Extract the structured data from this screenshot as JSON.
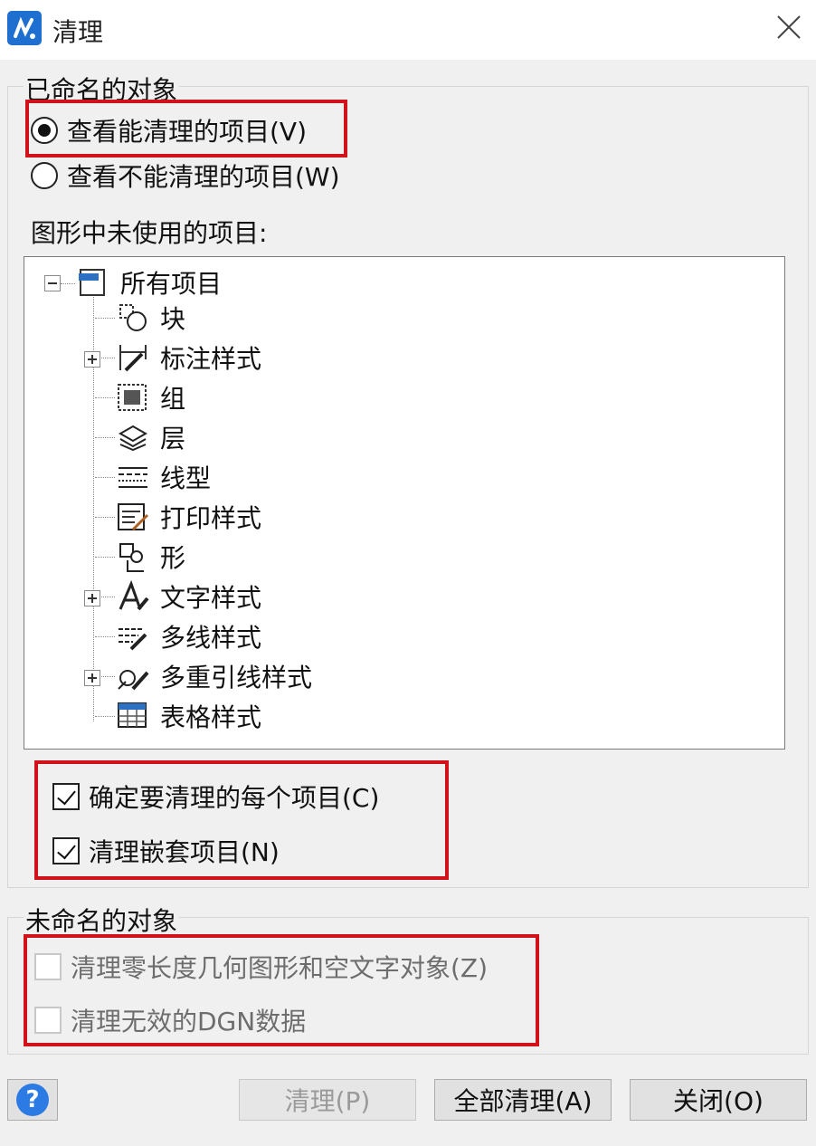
{
  "window": {
    "title": "清理"
  },
  "named_group": {
    "title": "已命名的对象",
    "radio_can_purge": "查看能清理的项目(V)",
    "radio_cannot_purge": "查看不能清理的项目(W)",
    "unused_label": "图形中未使用的项目:",
    "tree": {
      "root": "所有项目",
      "items": [
        "块",
        "标注样式",
        "组",
        "层",
        "线型",
        "打印样式",
        "形",
        "文字样式",
        "多线样式",
        "多重引线样式",
        "表格样式"
      ]
    },
    "check_confirm": "确定要清理的每个项目(C)",
    "check_nested": "清理嵌套项目(N)"
  },
  "unnamed_group": {
    "title": "未命名的对象",
    "check_zero_length": "清理零长度几何图形和空文字对象(Z)",
    "check_dgn": "清理无效的DGN数据"
  },
  "buttons": {
    "help": "?",
    "purge": "清理(P)",
    "purge_all": "全部清理(A)",
    "close": "关闭(O)"
  },
  "colors": {
    "highlight_box": "#d2121b",
    "app_icon": "#1f6fd1",
    "help_icon": "#2c7be5"
  }
}
